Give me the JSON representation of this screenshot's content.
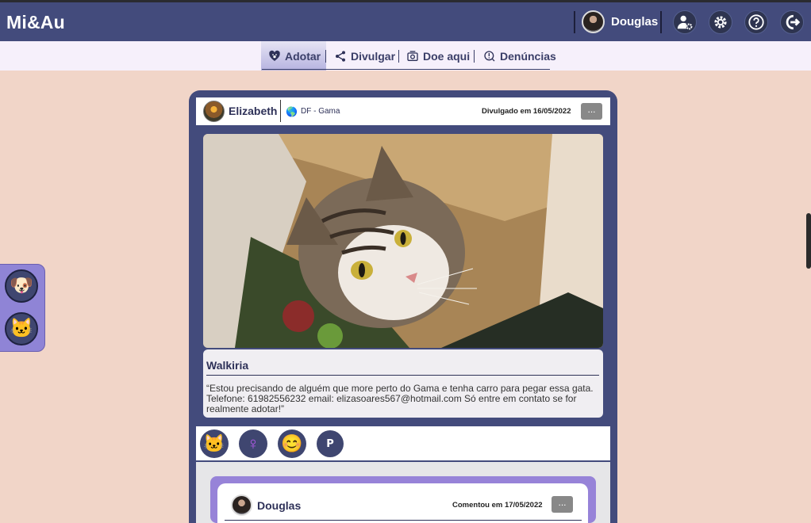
{
  "app": {
    "title": "Mi&Au"
  },
  "header": {
    "username": "Douglas"
  },
  "nav": {
    "items": [
      {
        "label": "Adotar",
        "icon": "heart-paw-icon",
        "active": true
      },
      {
        "label": "Divulgar",
        "icon": "share-icon",
        "active": false
      },
      {
        "label": "Doe aqui",
        "icon": "donation-icon",
        "active": false
      },
      {
        "label": "Denúncias",
        "icon": "report-icon",
        "active": false
      }
    ]
  },
  "sidebar": {
    "filters": [
      {
        "emoji": "🐶",
        "icon": "dog-icon"
      },
      {
        "emoji": "🐱",
        "icon": "cat-icon"
      }
    ]
  },
  "post": {
    "author": "Elizabeth",
    "location": "DF - Gama",
    "date": "Divulgado em 16/05/2022",
    "menu": "...",
    "pet_name": "Walkiria",
    "description": "“Estou precisando de alguém que more perto do Gama e tenha carro para pegar essa gata. Telefone: 61982556232 email: elizasoares567@hotmail.com Só entre em contato se for realmente adotar!”",
    "tags": [
      {
        "emoji": "🐱",
        "icon": "cat-icon"
      },
      {
        "emoji": "♀",
        "icon": "female-icon"
      },
      {
        "emoji": "😊",
        "icon": "smiley-icon"
      },
      {
        "emoji": "P",
        "icon": "size-small-icon"
      }
    ]
  },
  "comment": {
    "author": "Douglas",
    "date": "Comentou em 17/05/2022",
    "menu": "..."
  },
  "colors": {
    "header": "#434b7c",
    "background": "#f1d5c8",
    "accent": "#9783d8",
    "female": "#a05ad8"
  }
}
